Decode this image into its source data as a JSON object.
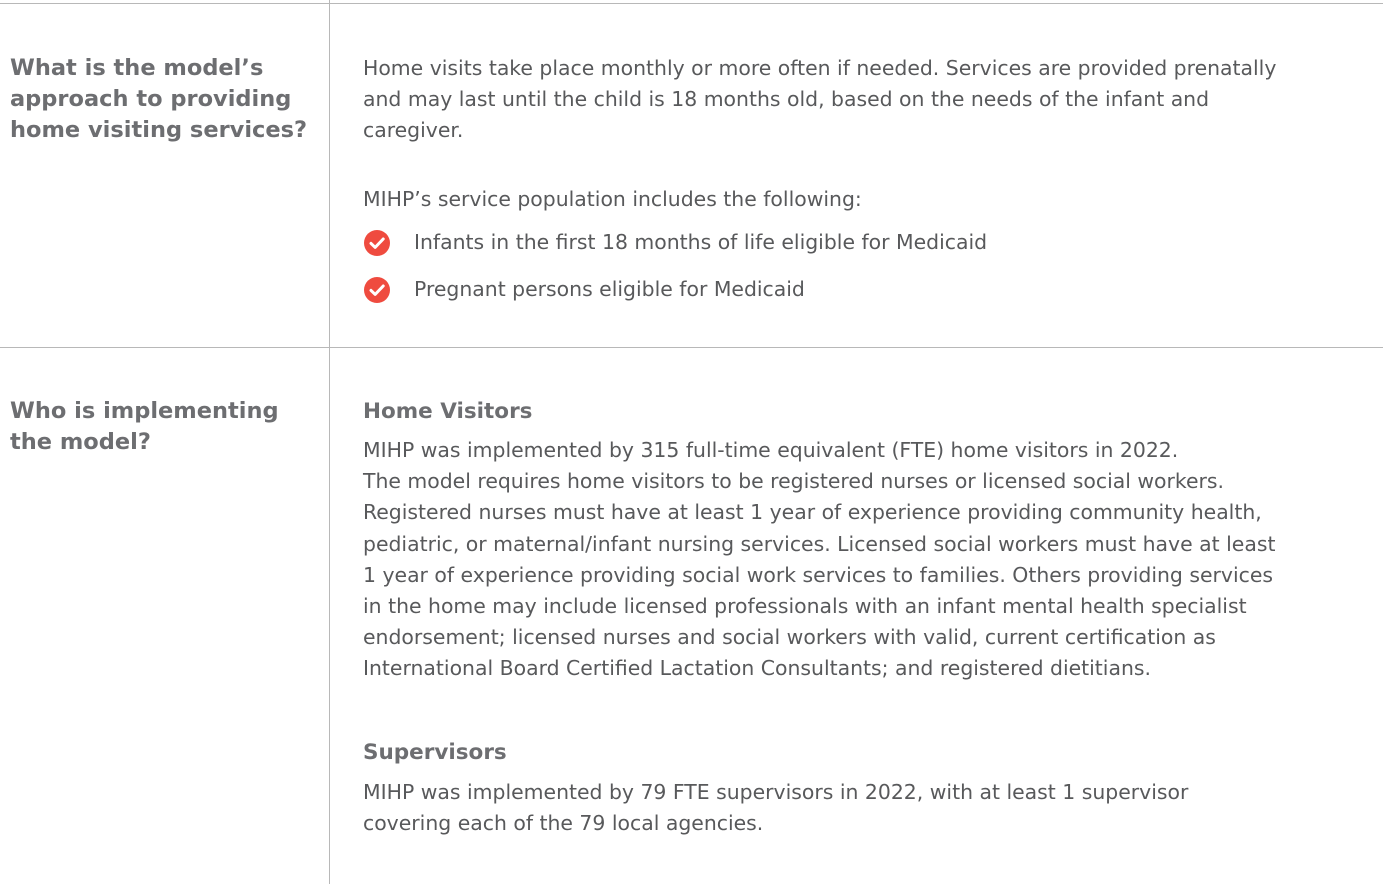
{
  "colors": {
    "accent_check": "#ef4b3f",
    "text": "#58595b",
    "heading": "#6d6e71",
    "rule": "#b8b8b8"
  },
  "section1": {
    "question_lines": [
      "What is the model’s",
      "approach to providing",
      "home visiting services?"
    ],
    "intro_lines": [
      "Home visits take place monthly or more often if needed. Services are provided prenatally",
      "and may last until the child is 18 months old, based on the needs of the infant and",
      "caregiver."
    ],
    "population_intro": "MIHP’s service population includes the following:",
    "population_items": [
      {
        "icon": "check-circle-icon",
        "label": "Infants in the first 18 months of life eligible for Medicaid"
      },
      {
        "icon": "check-circle-icon",
        "label": "Pregnant persons eligible for Medicaid"
      }
    ]
  },
  "section2": {
    "question_lines": [
      "Who is implementing",
      "the model?"
    ],
    "home_visitors": {
      "heading": "Home Visitors",
      "lines": [
        "MIHP was implemented by 315 full-time equivalent (FTE) home visitors in 2022.",
        "The model requires home visitors to be registered nurses or licensed social workers.",
        "Registered nurses must have at least 1 year of experience providing community health,",
        "pediatric, or maternal/infant nursing services. Licensed social workers must have at least",
        "1 year of experience providing social work services to families. Others providing services",
        "in the home may include licensed professionals with an infant mental health specialist",
        "endorsement; licensed nurses and social workers with valid, current certification as",
        "International Board Certified Lactation Consultants; and registered dietitians."
      ]
    },
    "supervisors": {
      "heading": "Supervisors",
      "lines": [
        "MIHP was implemented by 79 FTE supervisors in 2022, with at least 1 supervisor",
        "covering each of the 79 local agencies."
      ]
    }
  }
}
